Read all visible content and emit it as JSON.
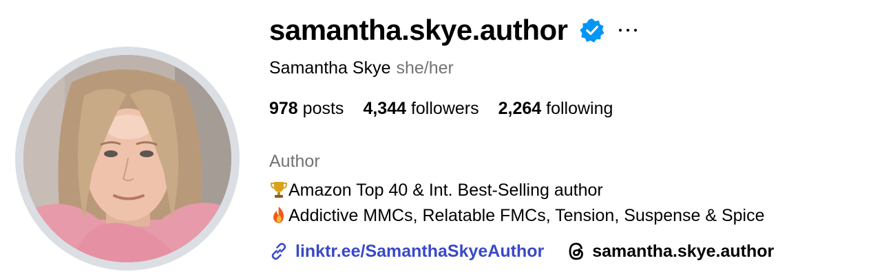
{
  "profile": {
    "username": "samantha.skye.author",
    "verified": true,
    "full_name": "Samantha Skye",
    "pronouns": "she/her",
    "stats": [
      {
        "count": "978",
        "label": "posts"
      },
      {
        "count": "4,344",
        "label": "followers"
      },
      {
        "count": "2,264",
        "label": "following"
      }
    ],
    "category": "Author",
    "bio": [
      {
        "emoji": "trophy-icon",
        "text": "Amazon Top 40 & Int. Best-Selling author"
      },
      {
        "emoji": "fire-icon",
        "text": "Addictive MMCs, Relatable FMCs, Tension, Suspense & Spice"
      }
    ],
    "link": {
      "icon": "link-icon",
      "text": "linktr.ee/SamanthaSkyeAuthor"
    },
    "threads": {
      "icon": "threads-icon",
      "text": "samantha.skye.author"
    }
  },
  "colors": {
    "verified_badge": "#0095f6",
    "link": "#3949c8",
    "secondary_text": "#737373",
    "avatar_ring": "#dbdfe4"
  }
}
